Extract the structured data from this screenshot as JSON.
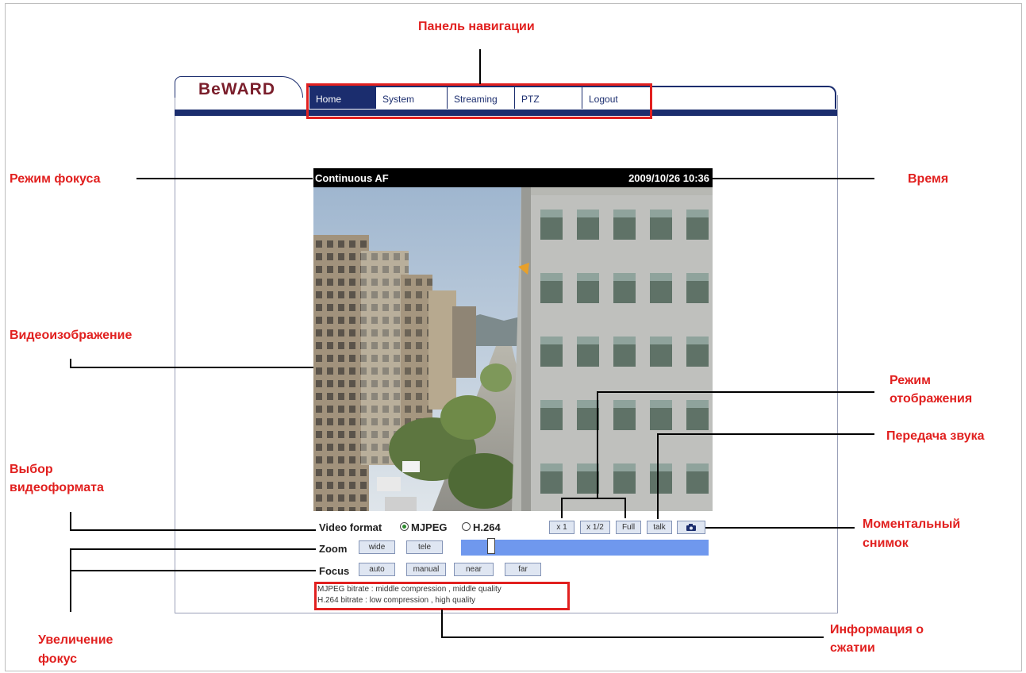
{
  "annotations": {
    "nav_panel": "Панель навигации",
    "focus_mode": "Режим фокуса",
    "time": "Время",
    "video_image": "Видеоизображение",
    "display_mode_1": "Режим",
    "display_mode_2": "отображения",
    "audio": "Передача звука",
    "format_select_1": "Выбор",
    "format_select_2": "видеоформата",
    "snapshot_1": "Моментальный",
    "snapshot_2": "снимок",
    "zoom_focus_1": "Увеличение",
    "zoom_focus_2": "фокус",
    "compression_1": "Информация о",
    "compression_2": "сжатии"
  },
  "logo": "BeWARD",
  "nav": [
    "Home",
    "System",
    "Streaming",
    "PTZ",
    "Logout"
  ],
  "video": {
    "focus_mode": "Continuous AF",
    "datetime": "2009/10/26 10:36"
  },
  "controls": {
    "video_format_label": "Video format",
    "format_options": [
      "MJPEG",
      "H.264"
    ],
    "selected_format": "MJPEG",
    "view_buttons": [
      "x 1",
      "x 1/2",
      "Full",
      "talk"
    ],
    "snapshot_icon": "camera-icon",
    "zoom_label": "Zoom",
    "zoom_buttons": [
      "wide",
      "tele"
    ],
    "zoom_level": 0.11,
    "focus_label": "Focus",
    "focus_buttons": [
      "auto",
      "manual",
      "near",
      "far"
    ],
    "info_lines": [
      "MJPEG bitrate : middle compression , middle quality",
      "H.264 bitrate : low compression , high quality"
    ]
  },
  "colors": {
    "accent_red": "#e1201f",
    "nav_blue": "#1b2d6e",
    "slider_blue": "#6f98ee"
  }
}
